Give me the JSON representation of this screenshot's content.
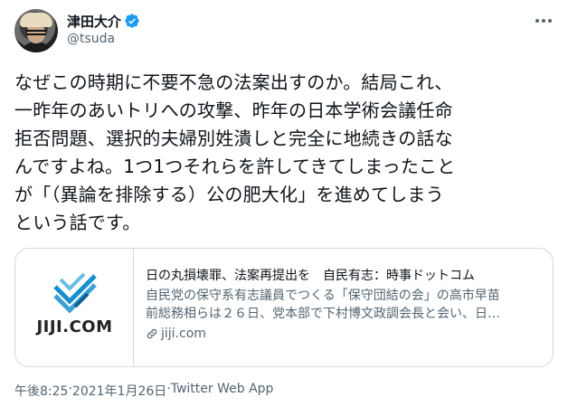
{
  "author": {
    "display_name": "津田大介",
    "handle": "@tsuda",
    "avatar_icon": "user-avatar",
    "verified_icon": "verified-badge-icon"
  },
  "more_icon": "more-icon",
  "tweet": {
    "lines": [
      "なぜこの時期に不要不急の法案出すのか。結局これ、",
      "一昨年のあいトリへの攻撃、昨年の日本学術会議任命",
      "拒否問題、選択的夫婦別姓潰しと完全に地続きの話な",
      "んですよね。1つ1つそれらを許してきてしまったこと",
      "が「（異論を排除する）公の肥大化」を進めてしまう",
      "という話です。"
    ]
  },
  "card": {
    "logo_text": "JIJI.COM",
    "title": "日の丸損壊罪、法案再提出を　自民有志：時事ドットコム",
    "description_lines": [
      "自民党の保守系有志議員でつくる「保守団結の会」の高市早苗",
      "前総務相らは２６日、党本部で下村博文政調会長と会い、日…"
    ],
    "domain": "jiji.com",
    "link_icon": "link-icon"
  },
  "meta": {
    "time": "午後8:25",
    "separator": " · ",
    "date": "2021年1月26日",
    "source": "Twitter Web App"
  },
  "colors": {
    "text": "#0f1419",
    "secondary": "#536471",
    "border": "#cfd9de",
    "verified": "#1d9bf0",
    "logo_blue": "#1a8fd0"
  }
}
